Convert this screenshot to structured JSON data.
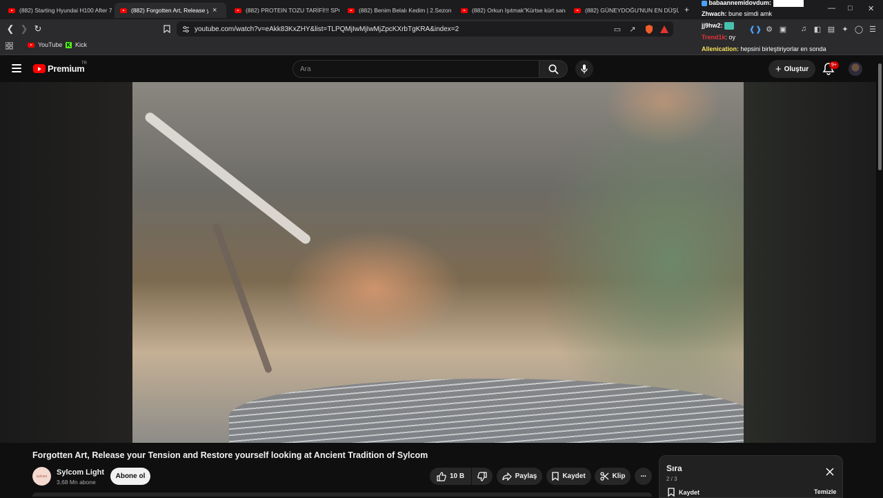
{
  "browser": {
    "tabs": [
      {
        "title": "(882) Starting Hyundai H100 After 7"
      },
      {
        "title": "(882) Forgotten Art, Release you"
      },
      {
        "title": "(882) PROTEIN TOZU TARİFİ!!! SPOR"
      },
      {
        "title": "(882) Benim Belalı Kedim | 2.Sezon 1"
      },
      {
        "title": "(882) Orkun Işıtmak\"Kürtse kürt sana"
      },
      {
        "title": "(882) GÜNEYDOĞU'NUN EN DÜŞÜK"
      }
    ],
    "url": "youtube.com/watch?v=eAkk83KxZHY&list=TLPQMjIwMjIwMjZpcKXrbTgKRA&index=2",
    "bookmarks": [
      {
        "label": "YouTube"
      },
      {
        "label": "Kick"
      }
    ],
    "new_tab_symbol": "+",
    "close_symbol": "×"
  },
  "chat": [
    {
      "user": "babaannemidovdum:",
      "message": ""
    },
    {
      "user": "Zhwach:",
      "message": "bune simdi amk"
    },
    {
      "user": "jj9hw2:",
      "message": ""
    },
    {
      "user": "Trend1k",
      "message": ": oy"
    },
    {
      "user": "Allenication:",
      "message": "hepsini birleştiriyorlar en sonda"
    }
  ],
  "youtube": {
    "logo_text": "Premium",
    "country_code": "TR",
    "search_placeholder": "Ara",
    "create_label": "Oluştur",
    "notification_count": "9+"
  },
  "video": {
    "title": "Forgotten Art, Release your Tension and Restore yourself looking at Ancient Tradition of Sylcom",
    "channel_name": "Sylcom Light",
    "channel_avatar_text": "sylcom",
    "subscribers": "3,68 Mn abone",
    "subscribe_label": "Abone ol",
    "like_count": "10 B",
    "share_label": "Paylaş",
    "save_label": "Kaydet",
    "clip_label": "Klip",
    "more_symbol": "···"
  },
  "queue": {
    "title": "Sıra",
    "position": "2 / 3",
    "save_label": "Kaydet",
    "clear_label": "Temizle"
  },
  "colors": {
    "youtube_red": "#ff0000",
    "page_bg": "#0f0f0f",
    "pill_bg": "#272727",
    "kick_green": "#53fc18"
  }
}
